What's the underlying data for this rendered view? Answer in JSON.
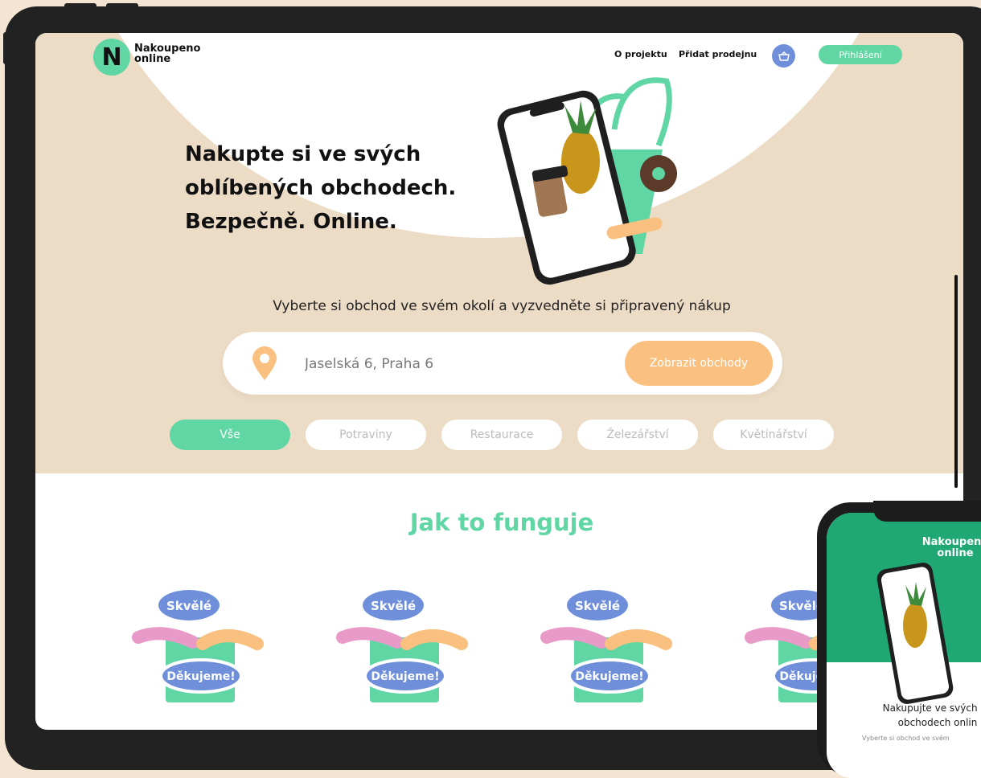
{
  "brand": {
    "line1": "Nakoupeno",
    "line2": "online",
    "logo_letter": "N"
  },
  "nav": {
    "about": "O projektu",
    "add_store": "Přidat prodejnu",
    "login": "Přihlášení"
  },
  "hero": {
    "title_line1": "Nakupte si ve svých",
    "title_line2": "oblíbených obchodech.",
    "title_line3": "Bezpečně. Online.",
    "subtitle": "Vyberte si obchod ve svém okolí a vyzvedněte si připravený nákup"
  },
  "search": {
    "value": "Jaselská 6, Praha 6",
    "button": "Zobrazit obchody"
  },
  "categories": [
    {
      "label": "Vše"
    },
    {
      "label": "Potraviny"
    },
    {
      "label": "Restaurace"
    },
    {
      "label": "Železářství"
    },
    {
      "label": "Květinářství"
    }
  ],
  "how": {
    "title": "Jak to funguje",
    "bubble_top": "Skvělé",
    "bubble_bottom": "Děkujeme!"
  },
  "phone": {
    "logo_line1": "Nakoupeno",
    "logo_line2": "online",
    "heading_line1": "Nakupujte ve svých ob",
    "heading_line2": "obchodech onlin",
    "sub": "Vyberte si obchod ve svém"
  },
  "colors": {
    "mint": "#5fd6a4",
    "beige": "#ecdcc6",
    "peach": "#fac07f",
    "blue": "#6f8fdb"
  }
}
